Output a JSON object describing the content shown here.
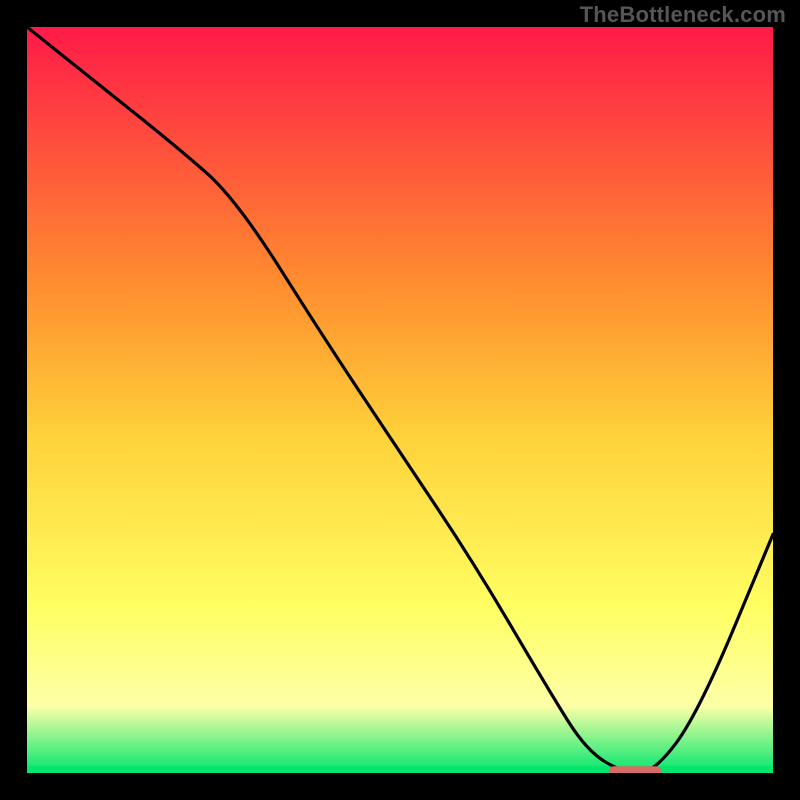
{
  "watermark": "TheBottleneck.com",
  "colors": {
    "background": "#000000",
    "gradient_top": "#ff1a48",
    "gradient_mid1": "#ff8f2f",
    "gradient_mid2": "#ffd23a",
    "gradient_mid3": "#ffff63",
    "gradient_mid4": "#fdffa7",
    "gradient_bottom": "#00e66e",
    "curve": "#000000",
    "marker": "#d86b66"
  },
  "chart_data": {
    "type": "line",
    "title": "",
    "xlabel": "",
    "ylabel": "",
    "xlim": [
      0,
      100
    ],
    "ylim": [
      0,
      100
    ],
    "series": [
      {
        "name": "bottleneck-curve",
        "x": [
          0,
          10,
          20,
          28,
          40,
          50,
          60,
          70,
          75,
          80,
          84,
          90,
          100
        ],
        "values": [
          100,
          92,
          84,
          77,
          58,
          43,
          28,
          11,
          3,
          0,
          0,
          8,
          32
        ]
      }
    ],
    "marker": {
      "name": "optimal-range-marker",
      "x_start": 78,
      "x_end": 85,
      "y": 0
    }
  }
}
